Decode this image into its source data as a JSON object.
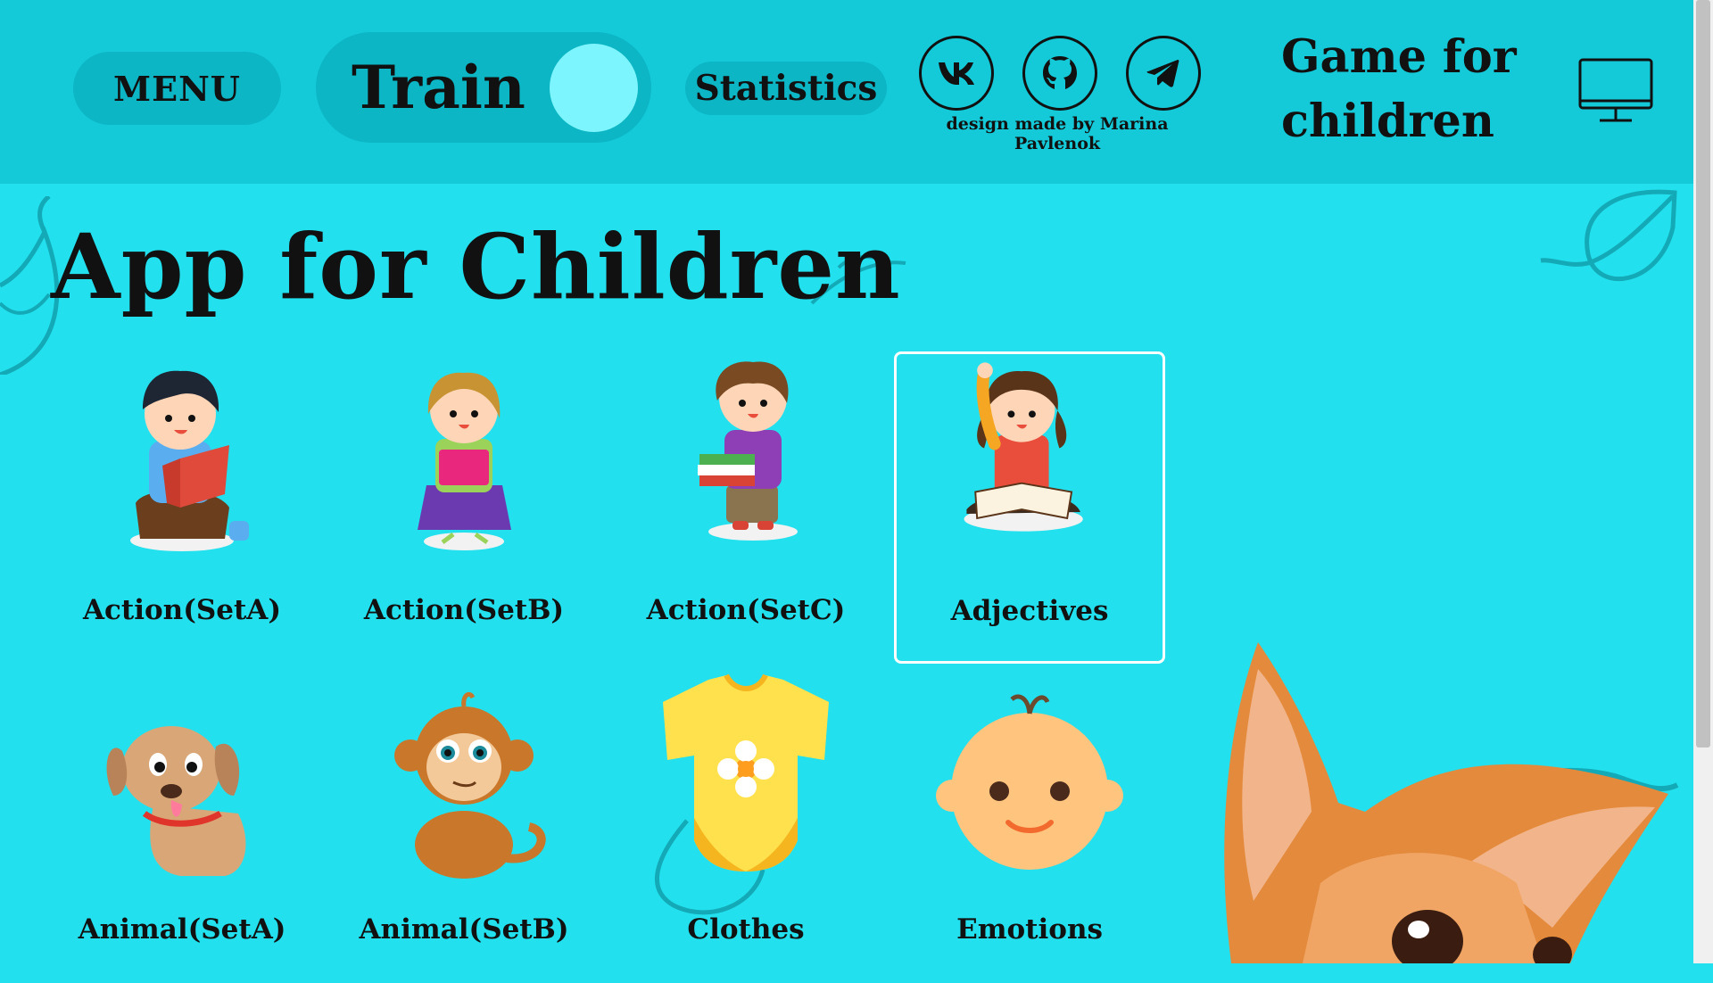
{
  "header": {
    "menu_label": "MENU",
    "mode_label": "Train",
    "statistics_label": "Statistics",
    "socials": [
      "vk-icon",
      "github-icon",
      "telegram-icon"
    ],
    "credit": "design made by Marina Pavlenok",
    "game_title_line1": "Game for",
    "game_title_line2": "children",
    "device_icon": "monitor-icon"
  },
  "main": {
    "title": "App for Children",
    "categories": [
      {
        "label": "Action(SetA)",
        "icon": "boy-reading-icon"
      },
      {
        "label": "Action(SetB)",
        "icon": "girl-with-book-icon"
      },
      {
        "label": "Action(SetC)",
        "icon": "boy-holding-books-icon"
      },
      {
        "label": "Adjectives",
        "icon": "girl-raising-hand-icon",
        "selected": true
      },
      {
        "label": "Animal(SetA)",
        "icon": "puppy-icon"
      },
      {
        "label": "Animal(SetB)",
        "icon": "monkey-icon"
      },
      {
        "label": "Clothes",
        "icon": "baby-bodysuit-icon"
      },
      {
        "label": "Emotions",
        "icon": "baby-face-icon"
      }
    ]
  },
  "colors": {
    "page_background": "#22e0ed",
    "header_background": "#14cad8",
    "button_background": "#0cb6c5",
    "toggle_knob": "#7df5fe",
    "selection_border": "#ffffff"
  }
}
